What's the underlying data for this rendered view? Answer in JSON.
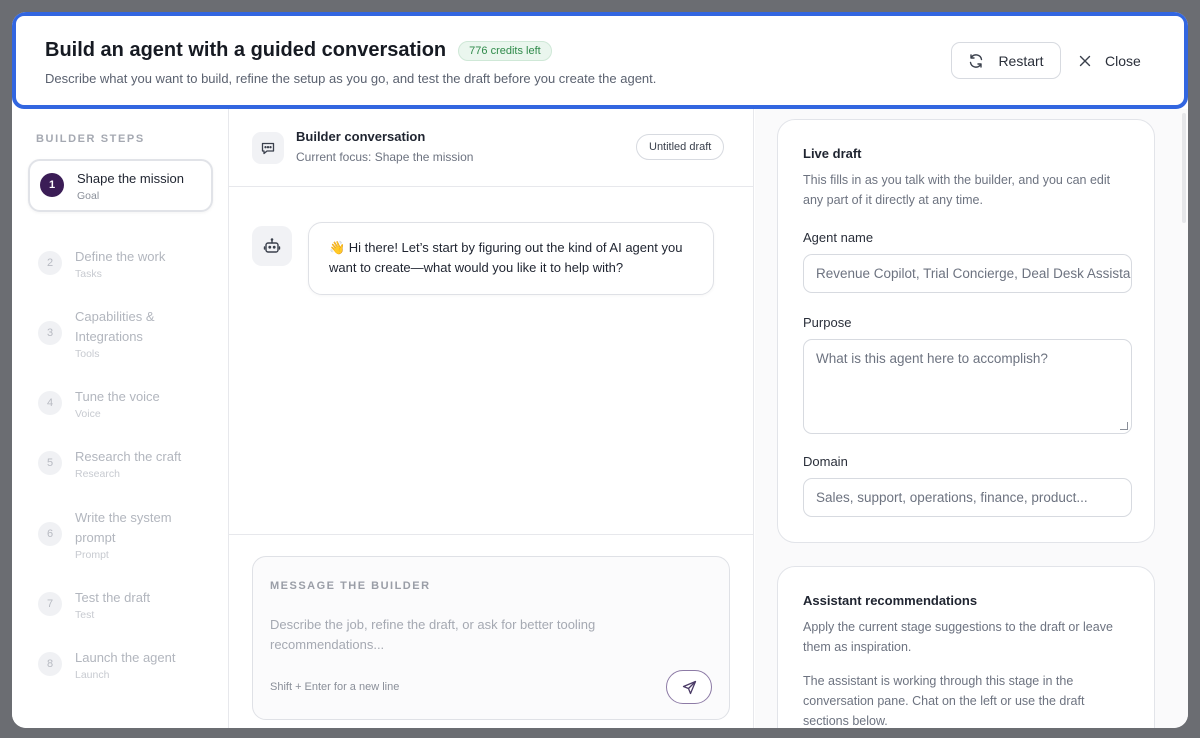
{
  "header": {
    "title": "Build an agent with a guided conversation",
    "credits": "776 credits left",
    "subtitle": "Describe what you want to build, refine the setup as you go, and test the draft before you create the agent.",
    "restart_label": "Restart",
    "close_label": "Close"
  },
  "sidebar": {
    "label": "BUILDER STEPS",
    "steps": [
      {
        "num": "1",
        "title": "Shape the mission",
        "sub": "Goal"
      },
      {
        "num": "2",
        "title": "Define the work",
        "sub": "Tasks"
      },
      {
        "num": "3",
        "title": "Capabilities & Integrations",
        "sub": "Tools"
      },
      {
        "num": "4",
        "title": "Tune the voice",
        "sub": "Voice"
      },
      {
        "num": "5",
        "title": "Research the craft",
        "sub": "Research"
      },
      {
        "num": "6",
        "title": "Write the system prompt",
        "sub": "Prompt"
      },
      {
        "num": "7",
        "title": "Test the draft",
        "sub": "Test"
      },
      {
        "num": "8",
        "title": "Launch the agent",
        "sub": "Launch"
      }
    ]
  },
  "conversation": {
    "title": "Builder conversation",
    "focus": "Current focus: Shape the mission",
    "draft_pill": "Untitled draft",
    "message": "👋 Hi there! Let’s start by figuring out the kind of AI agent you want to create—what would you like it to help with?",
    "composer_label": "MESSAGE THE BUILDER",
    "composer_placeholder": "Describe the job, refine the draft, or ask for better tooling recommendations...",
    "composer_hint": "Shift + Enter for a new line"
  },
  "live_draft": {
    "title": "Live draft",
    "desc": "This fills in as you talk with the builder, and you can edit any part of it directly at any time.",
    "agent_name_label": "Agent name",
    "agent_name_placeholder": "Revenue Copilot, Trial Concierge, Deal Desk Assistant",
    "purpose_label": "Purpose",
    "purpose_placeholder": "What is this agent here to accomplish?",
    "domain_label": "Domain",
    "domain_placeholder": "Sales, support, operations, finance, product..."
  },
  "recommendations": {
    "title": "Assistant recommendations",
    "desc": "Apply the current stage suggestions to the draft or leave them as inspiration.",
    "status": "The assistant is working through this stage in the conversation pane. Chat on the left or use the draft sections below."
  },
  "colors": {
    "accent_border": "#3266e0",
    "active_step": "#3b1d56",
    "credits_green": "#2f8a4a"
  }
}
